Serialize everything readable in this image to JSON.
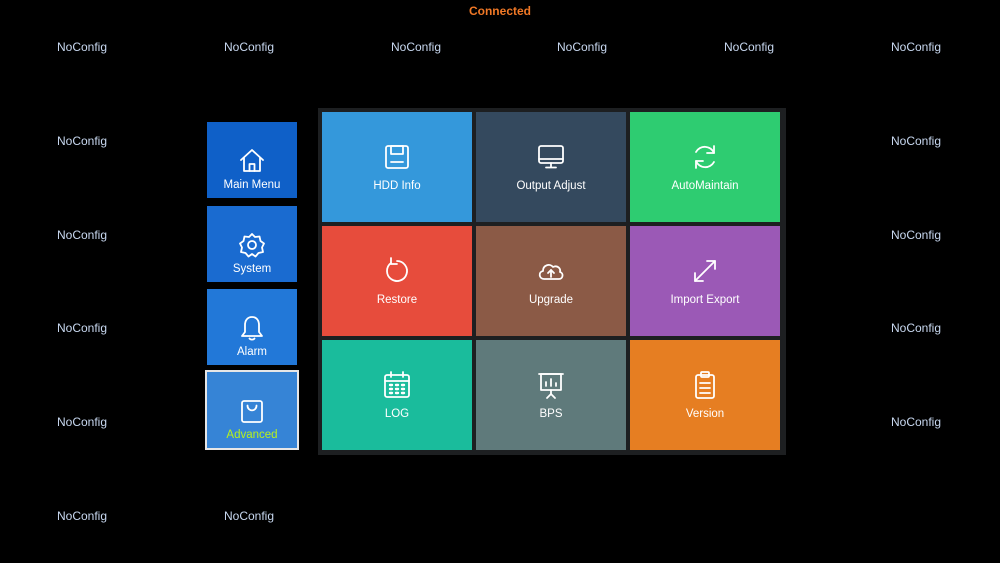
{
  "status": "Connected",
  "camera_label": "NoConfig",
  "sidebar": {
    "items": [
      {
        "label": "Main Menu",
        "icon": "home-icon",
        "color": "#0f60c8"
      },
      {
        "label": "System",
        "icon": "gear-icon",
        "color": "#1a6bd0"
      },
      {
        "label": "Alarm",
        "icon": "bell-icon",
        "color": "#2278d8"
      },
      {
        "label": "Advanced",
        "icon": "bag-icon",
        "color": "#3684d6",
        "active": true
      }
    ]
  },
  "tiles": [
    {
      "label": "HDD Info",
      "icon": "disk-icon",
      "color": "#3498db"
    },
    {
      "label": "Output Adjust",
      "icon": "monitor-icon",
      "color": "#34495e"
    },
    {
      "label": "AutoMaintain",
      "icon": "refresh-icon",
      "color": "#2ecc71"
    },
    {
      "label": "Restore",
      "icon": "restore-icon",
      "color": "#e74c3c"
    },
    {
      "label": "Upgrade",
      "icon": "cloud-upload-icon",
      "color": "#8b5a46"
    },
    {
      "label": "Import Export",
      "icon": "expand-arrows-icon",
      "color": "#9b59b6"
    },
    {
      "label": "LOG",
      "icon": "calendar-icon",
      "color": "#1abc9c"
    },
    {
      "label": "BPS",
      "icon": "presentation-chart-icon",
      "color": "#5f7a7b"
    },
    {
      "label": "Version",
      "icon": "clipboard-icon",
      "color": "#e67e22"
    }
  ]
}
